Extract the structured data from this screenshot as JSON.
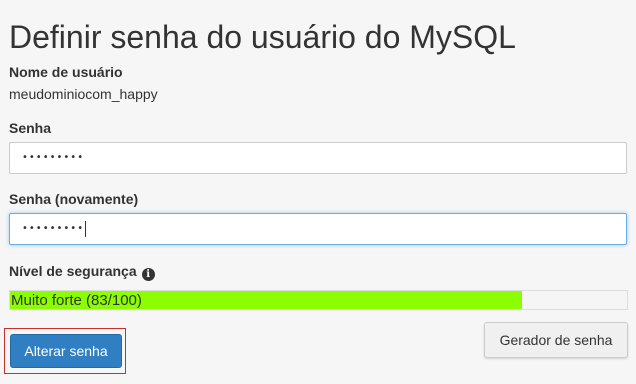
{
  "page": {
    "title": "Definir senha do usuário do MySQL"
  },
  "username": {
    "label": "Nome de usuário",
    "value": "meudominiocom_happy"
  },
  "password": {
    "label": "Senha",
    "masked_value": "•••••••••"
  },
  "password_confirm": {
    "label": "Senha (novamente)",
    "masked_value": "•••••••••"
  },
  "strength": {
    "label": "Nível de segurança",
    "info_icon": "info-icon",
    "text": "Muito forte (83/100)",
    "score": 83,
    "max": 100,
    "fill_color": "#8bff00"
  },
  "actions": {
    "change_password_label": "Alterar senha",
    "password_generator_label": "Gerador de senha"
  },
  "colors": {
    "primary_button": "#2f7fc2",
    "focus_border": "#66afe9",
    "highlight_outline": "#c9302c"
  }
}
